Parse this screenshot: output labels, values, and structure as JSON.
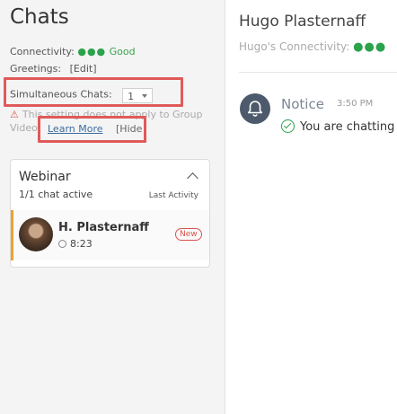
{
  "left": {
    "title": "Chats",
    "connectivity": {
      "label": "Connectivity:",
      "dots": "●●●",
      "status": "Good"
    },
    "greetings": {
      "label": "Greetings:",
      "edit": "[Edit]"
    },
    "simultaneous": {
      "label": "Simultaneous Chats:",
      "value": "1"
    },
    "warning": {
      "text": "This setting does not apply to Group Video.",
      "learn_more": "Learn More",
      "hide": "[Hide"
    },
    "group": {
      "title": "Webinar",
      "subtitle": "1/1 chat active",
      "sort_label": "Last Activity",
      "items": [
        {
          "name": "H. Plasternaff",
          "time": "8:23",
          "badge": "New"
        }
      ]
    }
  },
  "right": {
    "title": "Hugo Plasternaff",
    "connectivity_label": "Hugo's Connectivity:",
    "connectivity_dots": "●●●",
    "notice": {
      "title": "Notice",
      "time": "3:50 PM",
      "message": "You are chatting"
    }
  },
  "colors": {
    "accent_orange": "#f0a030",
    "good_green": "#2ba24c",
    "highlight_red": "#e05a5a",
    "badge_red": "#d9534f"
  }
}
